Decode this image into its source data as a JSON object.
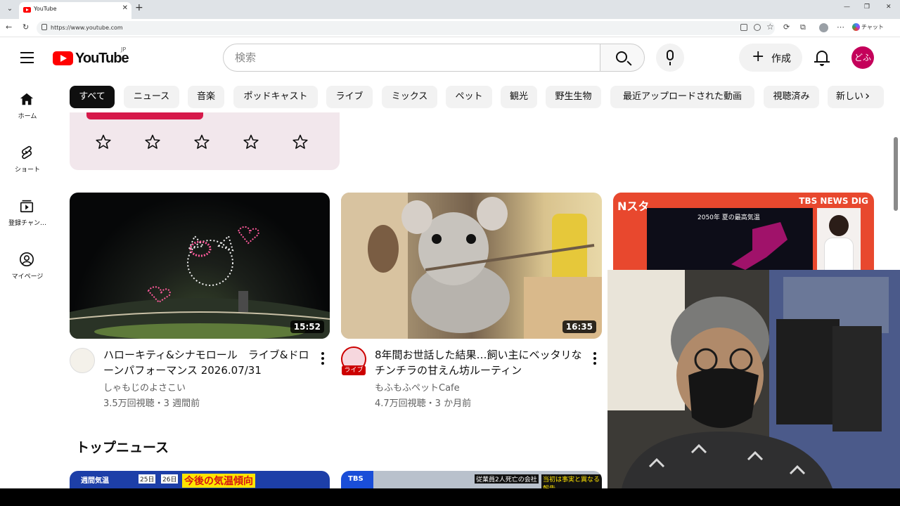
{
  "browser": {
    "tab_title": "YouTube",
    "url": "https://www.youtube.com",
    "chat_label": "チャット"
  },
  "header": {
    "logo_text": "YouTube",
    "region": "JP",
    "search_placeholder": "検索",
    "create_label": "作成",
    "avatar_text": "どふ"
  },
  "sidebar": {
    "items": [
      {
        "label": "ホーム",
        "icon": "home-icon"
      },
      {
        "label": "ショート",
        "icon": "shorts-icon"
      },
      {
        "label": "登録チャン…",
        "icon": "subscriptions-icon"
      },
      {
        "label": "マイページ",
        "icon": "account-icon"
      }
    ]
  },
  "chips": [
    "すべて",
    "ニュース",
    "音楽",
    "ポッドキャスト",
    "ライブ",
    "ミックス",
    "ペット",
    "観光",
    "野生生物",
    "最近アップロードされた動画",
    "視聴済み",
    "新しい"
  ],
  "survey": {
    "star_count": 5
  },
  "videos": [
    {
      "title": "ハローキティ&シナモロール　ライブ&ドローンパフォーマンス 2026.07/31",
      "channel": "しゃもじのよさこい",
      "meta": "3.5万回視聴・3 週間前",
      "duration": "15:52"
    },
    {
      "title": "8年間お世話した結果…飼い主にベッタリなチンチラの甘えん坊ルーティン",
      "channel": "もふもふペットCafe",
      "meta": "4.7万回視聴・3 か月前",
      "duration": "16:35",
      "live_badge": "ライブ"
    },
    {
      "thumb_brand": "Nスタ",
      "thumb_source": "TBS NEWS DIG",
      "thumb_caption": "2050年 夏の最高気温"
    }
  ],
  "top_news": {
    "title": "トップニュース",
    "thumb1_texts": [
      "週間気温",
      "25日",
      "26日",
      "今後の気温傾向"
    ],
    "thumb2_texts": [
      "TBS",
      "従業員2人死亡の会社",
      "当初は事実と異なる報告"
    ]
  },
  "colors": {
    "brand_red": "#ff0000",
    "avatar": "#c4005a",
    "chip_active": "#0f0f0f"
  }
}
